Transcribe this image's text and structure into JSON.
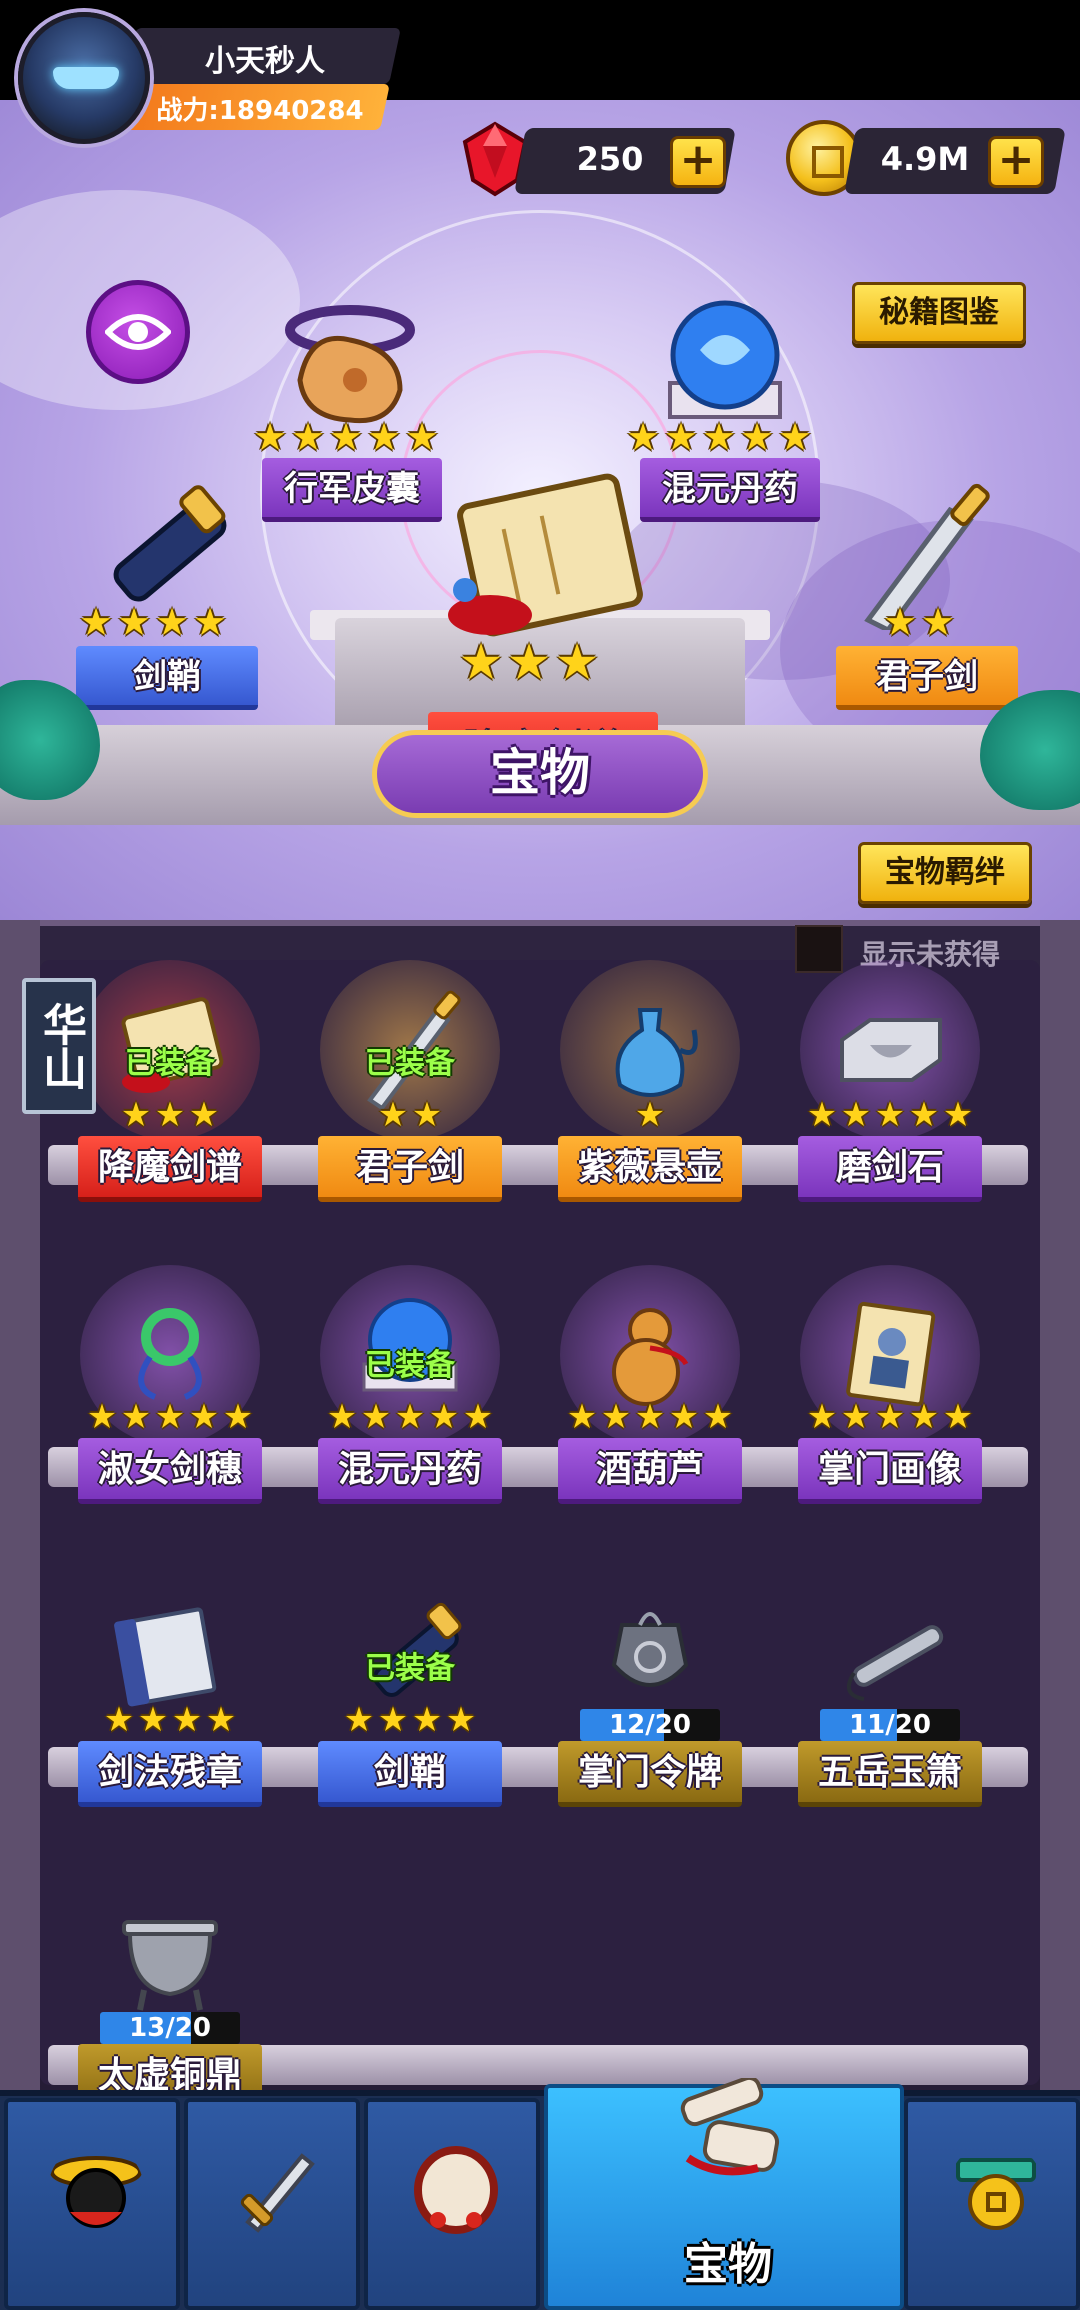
{
  "player": {
    "name": "小天秒人",
    "power_label": "战力:",
    "power_value": "18940284"
  },
  "currency": {
    "gems": "250",
    "gold": "4.9M",
    "plus_symbol": "+"
  },
  "buttons": {
    "codex": "秘籍图鉴",
    "bonds": "宝物羁绊",
    "show_unobtained": "显示未获得"
  },
  "hero_display": {
    "title": "宝物",
    "center": {
      "name": "降魔剑谱",
      "stars": 3
    },
    "top_left": {
      "name": "行军皮囊",
      "stars": 5
    },
    "top_right": {
      "name": "混元丹药",
      "stars": 5
    },
    "left": {
      "name": "剑鞘",
      "stars": 4
    },
    "right": {
      "name": "君子剑",
      "stars": 2
    }
  },
  "sect_tag": "华山",
  "equipped_label": "已装备",
  "treasures": [
    {
      "name": "降魔剑谱",
      "stars": 3,
      "equipped": true,
      "color": "red"
    },
    {
      "name": "君子剑",
      "stars": 2,
      "equipped": true,
      "color": "orange"
    },
    {
      "name": "紫薇悬壶",
      "stars": 1,
      "equipped": false,
      "color": "orange"
    },
    {
      "name": "磨剑石",
      "stars": 5,
      "equipped": false,
      "color": "purple"
    },
    {
      "name": "淑女剑穗",
      "stars": 5,
      "equipped": false,
      "color": "purple"
    },
    {
      "name": "混元丹药",
      "stars": 5,
      "equipped": true,
      "color": "purple"
    },
    {
      "name": "酒葫芦",
      "stars": 5,
      "equipped": false,
      "color": "purple"
    },
    {
      "name": "掌门画像",
      "stars": 5,
      "equipped": false,
      "color": "purple"
    },
    {
      "name": "剑法残章",
      "stars": 4,
      "equipped": false,
      "color": "blue"
    },
    {
      "name": "剑鞘",
      "stars": 4,
      "equipped": true,
      "color": "blue"
    },
    {
      "name": "掌门令牌",
      "stars": 0,
      "equipped": false,
      "color": "gold",
      "fragments": "12/20",
      "fraction": 0.6
    },
    {
      "name": "五岳玉箫",
      "stars": 0,
      "equipped": false,
      "color": "gold",
      "fragments": "11/20",
      "fraction": 0.55
    },
    {
      "name": "太虚铜鼎",
      "stars": 0,
      "equipped": false,
      "color": "gold",
      "fragments": "13/20",
      "fraction": 0.65
    }
  ],
  "nav": {
    "active_label": "宝物",
    "items": [
      "hero-icon",
      "sword-icon",
      "drum-icon",
      "treasure-scroll-icon",
      "shop-coin-icon"
    ]
  },
  "colors": {
    "accent_gold": "#f5c21a",
    "equipped_green": "#9cff4a",
    "fragment_blue": "#2f86e8"
  }
}
